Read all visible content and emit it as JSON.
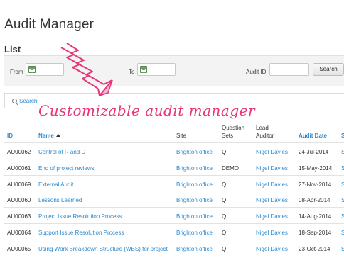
{
  "page": {
    "title": "Audit Manager",
    "subtitle": "List"
  },
  "filters": {
    "from_label": "From",
    "to_label": "To",
    "audit_id_label": "Audit ID",
    "search_button": "Search"
  },
  "search_link": "Search",
  "annotation": "Customizable audit manager",
  "table": {
    "headers": {
      "id": "ID",
      "name": "Name",
      "site": "Site",
      "question_sets_1": "Question",
      "question_sets_2": "Sets",
      "lead_auditor_1": "Lead",
      "lead_auditor_2": "Auditor",
      "audit_date": "Audit Date",
      "extra": "S"
    },
    "rows": [
      {
        "id": "AU00062",
        "name": "Control of R and D",
        "site": "Brighton office",
        "qs": "Q",
        "lead": "Nigel Davies",
        "date": "24-Jul-2014",
        "extra": "S"
      },
      {
        "id": "AU00061",
        "name": "End of project reviews",
        "site": "Brighton office",
        "qs": "DEMO",
        "lead": "Nigel Davies",
        "date": "15-May-2014",
        "extra": "S"
      },
      {
        "id": "AU00069",
        "name": "External Audit",
        "site": "Brighton office",
        "qs": "Q",
        "lead": "Nigel Davies",
        "date": "27-Nov-2014",
        "extra": "S"
      },
      {
        "id": "AU00060",
        "name": "Lessons Learned",
        "site": "Brighton office",
        "qs": "Q",
        "lead": "Nigel Davies",
        "date": "08-Apr-2014",
        "extra": "S"
      },
      {
        "id": "AU00063",
        "name": "Project Issue Resolution Process",
        "site": "Brighton office",
        "qs": "Q",
        "lead": "Nigel Davies",
        "date": "14-Aug-2014",
        "extra": "S"
      },
      {
        "id": "AU00064",
        "name": "Support Issue Resolution Process",
        "site": "Brighton office",
        "qs": "Q",
        "lead": "Nigel Davies",
        "date": "18-Sep-2014",
        "extra": "S"
      },
      {
        "id": "AU00065",
        "name": "Using Work Breakdown Structure (WBS) for project",
        "site": "Brighton office",
        "qs": "Q",
        "lead": "Nigel Davies",
        "date": "23-Oct-2014",
        "extra": "S"
      }
    ]
  },
  "colors": {
    "link": "#2a8ad0",
    "annotation": "#e8357a"
  }
}
